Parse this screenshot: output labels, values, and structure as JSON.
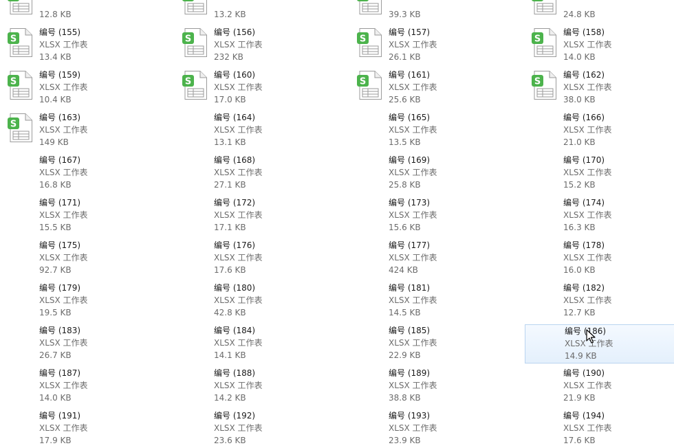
{
  "icons": {
    "file": "xlsx-spreadsheet-icon",
    "cursor": "mouse-pointer-icon"
  },
  "colors": {
    "icon_green": "#4cb34c",
    "hover_border": "#b9d4f0",
    "hover_bg": "#e8f2fc"
  },
  "files": [
    {
      "name": "",
      "type": "",
      "size": "12.8 KB",
      "icon": true
    },
    {
      "name": "",
      "type": "",
      "size": "13.2 KB",
      "icon": true
    },
    {
      "name": "",
      "type": "",
      "size": "39.3 KB",
      "icon": true
    },
    {
      "name": "",
      "type": "",
      "size": "24.8 KB",
      "icon": true
    },
    {
      "name": "编号 (155)",
      "type": "XLSX 工作表",
      "size": "13.4 KB",
      "icon": true
    },
    {
      "name": "编号 (156)",
      "type": "XLSX 工作表",
      "size": "232 KB",
      "icon": true
    },
    {
      "name": "编号 (157)",
      "type": "XLSX 工作表",
      "size": "26.1 KB",
      "icon": true
    },
    {
      "name": "编号 (158)",
      "type": "XLSX 工作表",
      "size": "14.0 KB",
      "icon": true
    },
    {
      "name": "编号 (159)",
      "type": "XLSX 工作表",
      "size": "10.4 KB",
      "icon": true
    },
    {
      "name": "编号 (160)",
      "type": "XLSX 工作表",
      "size": "17.0 KB",
      "icon": true
    },
    {
      "name": "编号 (161)",
      "type": "XLSX 工作表",
      "size": "25.6 KB",
      "icon": true
    },
    {
      "name": "编号 (162)",
      "type": "XLSX 工作表",
      "size": "38.0 KB",
      "icon": true
    },
    {
      "name": "编号 (163)",
      "type": "XLSX 工作表",
      "size": "149 KB",
      "icon": true
    },
    {
      "name": "编号 (164)",
      "type": "XLSX 工作表",
      "size": "13.1 KB",
      "icon": false
    },
    {
      "name": "编号 (165)",
      "type": "XLSX 工作表",
      "size": "13.5 KB",
      "icon": false
    },
    {
      "name": "编号 (166)",
      "type": "XLSX 工作表",
      "size": "21.0 KB",
      "icon": false
    },
    {
      "name": "编号 (167)",
      "type": "XLSX 工作表",
      "size": "16.8 KB",
      "icon": false
    },
    {
      "name": "编号 (168)",
      "type": "XLSX 工作表",
      "size": "27.1 KB",
      "icon": false
    },
    {
      "name": "编号 (169)",
      "type": "XLSX 工作表",
      "size": "25.8 KB",
      "icon": false
    },
    {
      "name": "编号 (170)",
      "type": "XLSX 工作表",
      "size": "15.2 KB",
      "icon": false
    },
    {
      "name": "编号 (171)",
      "type": "XLSX 工作表",
      "size": "15.5 KB",
      "icon": false
    },
    {
      "name": "编号 (172)",
      "type": "XLSX 工作表",
      "size": "17.1 KB",
      "icon": false
    },
    {
      "name": "编号 (173)",
      "type": "XLSX 工作表",
      "size": "15.6 KB",
      "icon": false
    },
    {
      "name": "编号 (174)",
      "type": "XLSX 工作表",
      "size": "16.3 KB",
      "icon": false
    },
    {
      "name": "编号 (175)",
      "type": "XLSX 工作表",
      "size": "92.7 KB",
      "icon": false
    },
    {
      "name": "编号 (176)",
      "type": "XLSX 工作表",
      "size": "17.6 KB",
      "icon": false
    },
    {
      "name": "编号 (177)",
      "type": "XLSX 工作表",
      "size": "424 KB",
      "icon": false
    },
    {
      "name": "编号 (178)",
      "type": "XLSX 工作表",
      "size": "16.0 KB",
      "icon": false
    },
    {
      "name": "编号 (179)",
      "type": "XLSX 工作表",
      "size": "19.5 KB",
      "icon": false
    },
    {
      "name": "编号 (180)",
      "type": "XLSX 工作表",
      "size": "42.8 KB",
      "icon": false
    },
    {
      "name": "编号 (181)",
      "type": "XLSX 工作表",
      "size": "14.5 KB",
      "icon": false
    },
    {
      "name": "编号 (182)",
      "type": "XLSX 工作表",
      "size": "12.7 KB",
      "icon": false
    },
    {
      "name": "编号 (183)",
      "type": "XLSX 工作表",
      "size": "26.7 KB",
      "icon": false
    },
    {
      "name": "编号 (184)",
      "type": "XLSX 工作表",
      "size": "14.1 KB",
      "icon": false
    },
    {
      "name": "编号 (185)",
      "type": "XLSX 工作表",
      "size": "22.9 KB",
      "icon": false
    },
    {
      "name": "编号 (186)",
      "type": "XLSX 工作表",
      "size": "14.9 KB",
      "icon": false,
      "hovered": true
    },
    {
      "name": "编号 (187)",
      "type": "XLSX 工作表",
      "size": "14.0 KB",
      "icon": false
    },
    {
      "name": "编号 (188)",
      "type": "XLSX 工作表",
      "size": "14.2 KB",
      "icon": false
    },
    {
      "name": "编号 (189)",
      "type": "XLSX 工作表",
      "size": "38.8 KB",
      "icon": false
    },
    {
      "name": "编号 (190)",
      "type": "XLSX 工作表",
      "size": "21.9 KB",
      "icon": false
    },
    {
      "name": "编号 (191)",
      "type": "XLSX 工作表",
      "size": "17.9 KB",
      "icon": false
    },
    {
      "name": "编号 (192)",
      "type": "XLSX 工作表",
      "size": "23.6 KB",
      "icon": false
    },
    {
      "name": "编号 (193)",
      "type": "XLSX 工作表",
      "size": "23.9 KB",
      "icon": false
    },
    {
      "name": "编号 (194)",
      "type": "XLSX 工作表",
      "size": "17.6 KB",
      "icon": false
    }
  ]
}
